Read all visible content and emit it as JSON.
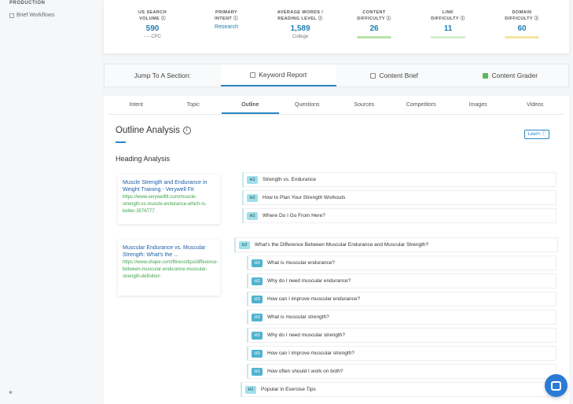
{
  "sidebar": {
    "section": "PRODUCTION",
    "item": "Brief Workflows",
    "bottom_icon": "gear-icon"
  },
  "stats": [
    {
      "label1": "US SEARCH",
      "label2": "VOLUME",
      "value": "590",
      "sub": "- -- CPC",
      "bar_color": ""
    },
    {
      "label1": "PRIMARY",
      "label2": "INTENT",
      "value": "Research",
      "sub": "",
      "bar_color": ""
    },
    {
      "label1": "AVERAGE WORDS /",
      "label2": "READING LEVEL",
      "value": "1,589",
      "sub": "College",
      "bar_color": ""
    },
    {
      "label1": "CONTENT",
      "label2": "DIFFICULTY",
      "value": "26",
      "sub": "",
      "bar_color": "#b7e3a8"
    },
    {
      "label1": "LINK",
      "label2": "DIFFICULTY",
      "value": "11",
      "sub": "",
      "bar_color": "#d5eecb"
    },
    {
      "label1": "DOMAIN",
      "label2": "DIFFICULTY",
      "value": "60",
      "sub": "",
      "bar_color": "#f3e7a2"
    }
  ],
  "jump": {
    "label": "Jump To A Section:",
    "sections": [
      "Keyword Report",
      "Content Brief",
      "Content Grader"
    ]
  },
  "tabs": [
    "Intent",
    "Topic",
    "Outline",
    "Questions",
    "Sources",
    "Competitors",
    "Images",
    "Videos"
  ],
  "outline": {
    "title": "Outline Analysis",
    "learn": "Learn",
    "subhead": "Heading Analysis"
  },
  "sources": [
    {
      "title": "Muscle Strength and Endurance in Weight Training - Verywell Fit",
      "url": "https://www.verywellfit.com/muscle-strength-vs-muscle-endurance-which-is-better-3576777"
    },
    {
      "title": "Muscular Endurance vs. Muscular Strength: What's the ...",
      "url": "https://www.shape.com/fitness/tips/difference-between-muscular-endurance-muscular-strength-definition"
    }
  ],
  "headings": [
    {
      "level": "H2",
      "text": "Strength vs. Endurance"
    },
    {
      "level": "H2",
      "text": "How to Plan Your Strength Workouts"
    },
    {
      "level": "H2",
      "text": "Where Do I Go From Here?"
    },
    {
      "level": "H2",
      "text": "What's the Difference Between Muscular Endurance and Muscular Strength?"
    },
    {
      "level": "H3",
      "text": "What is muscular endurance?"
    },
    {
      "level": "H3",
      "text": "Why do I need muscular endurance?"
    },
    {
      "level": "H3",
      "text": "How can I improve muscular endurance?"
    },
    {
      "level": "H3",
      "text": "What is muscular strength?"
    },
    {
      "level": "H3",
      "text": "Why do I need muscular strength?"
    },
    {
      "level": "H3",
      "text": "How can I improve muscular strength?"
    },
    {
      "level": "H3",
      "text": "How often should I work on both?"
    },
    {
      "level": "H2",
      "text": "Popular in Exercise Tips"
    }
  ],
  "colors": {
    "accent": "#2a85c4",
    "link": "#1f5fa8",
    "url": "#3da34a",
    "h2_badge": "#9fe0ea",
    "h3_badge": "#4fb3cf"
  }
}
